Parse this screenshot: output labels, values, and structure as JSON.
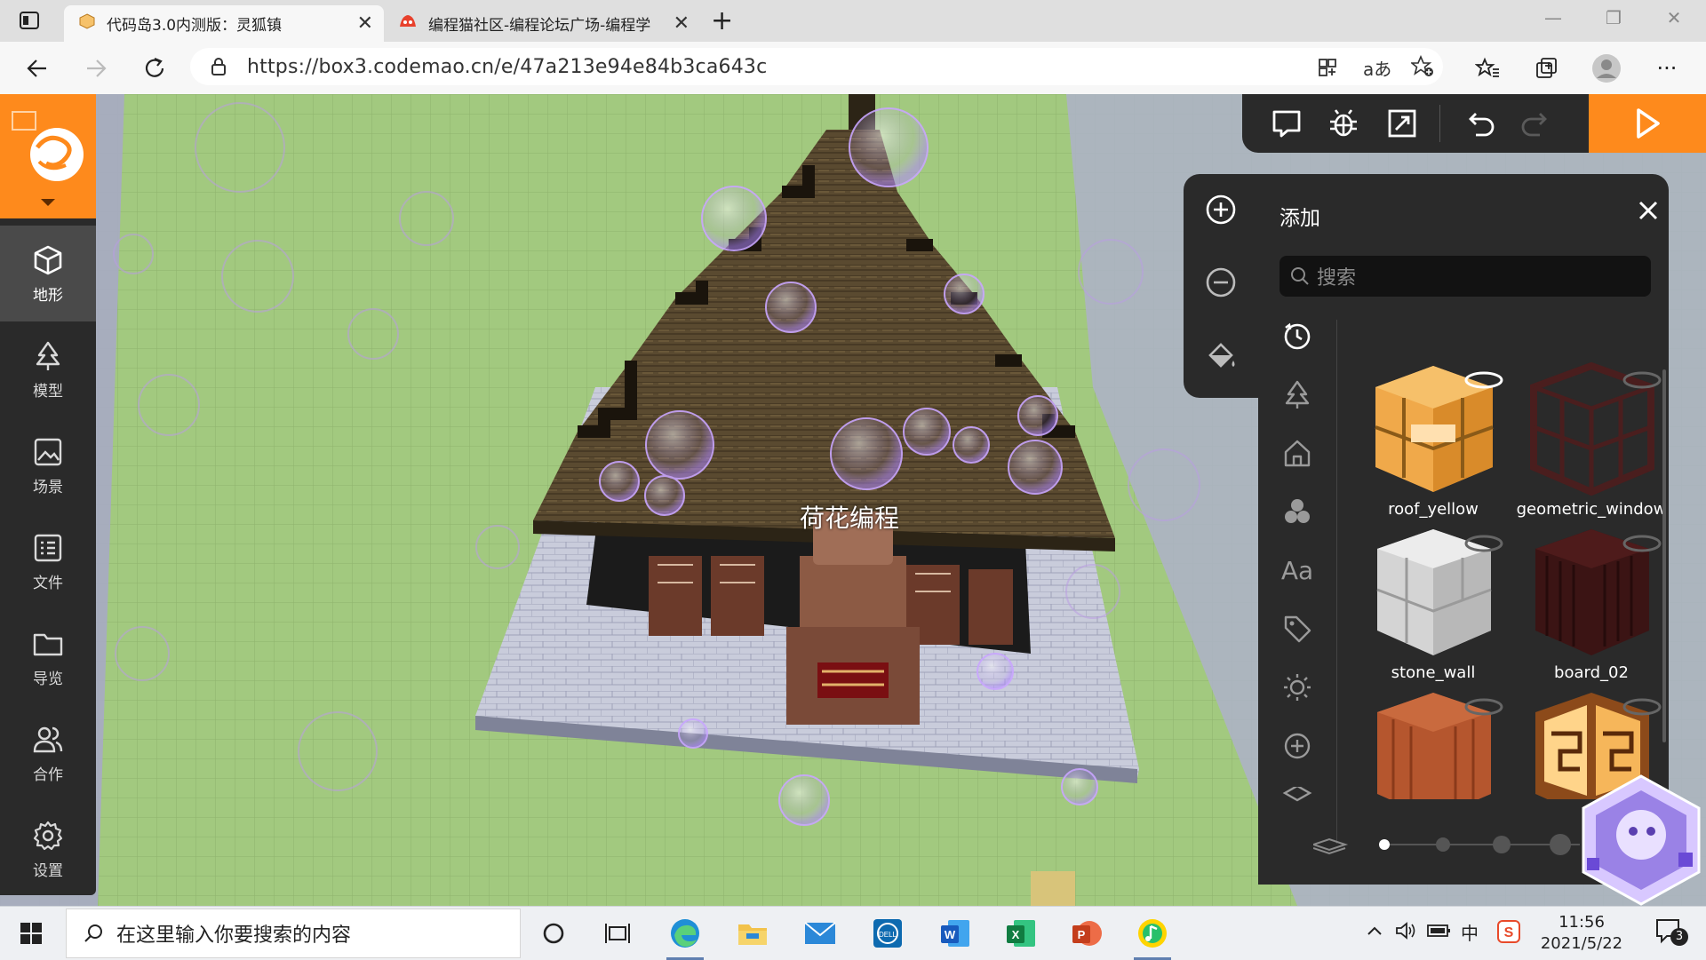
{
  "browser": {
    "tabs": [
      {
        "title": "代码岛3.0内测版：灵狐镇",
        "active": true
      },
      {
        "title": "编程猫社区-编程论坛广场-编程学",
        "active": false
      }
    ],
    "new_tab": "+",
    "url": "https://box3.codemao.cn/e/47a213e94e84b3ca643c"
  },
  "sidebar": {
    "items": [
      {
        "label": "地形",
        "icon": "cube-icon",
        "active": true
      },
      {
        "label": "模型",
        "icon": "tree-icon",
        "active": false
      },
      {
        "label": "场景",
        "icon": "picture-icon",
        "active": false
      },
      {
        "label": "文件",
        "icon": "list-icon",
        "active": false
      },
      {
        "label": "导览",
        "icon": "folder-icon",
        "active": false
      },
      {
        "label": "合作",
        "icon": "users-icon",
        "active": false
      },
      {
        "label": "设置",
        "icon": "gear-icon",
        "active": false
      }
    ]
  },
  "scene": {
    "player_name": "荷花编程"
  },
  "panel": {
    "title": "添加",
    "search_placeholder": "搜索",
    "items": [
      {
        "label": "roof_yellow",
        "color": "#f0a94a"
      },
      {
        "label": "geometric_window",
        "color": "#4a1e1e"
      },
      {
        "label": "stone_wall",
        "color": "#d9d9d9"
      },
      {
        "label": "board_02",
        "color": "#3b1414"
      },
      {
        "label": "",
        "color": "#b5562e"
      },
      {
        "label": "",
        "color": "#8c4a1a"
      }
    ],
    "categories": [
      "history-icon",
      "tree-icon",
      "house-icon",
      "shapes-icon",
      "text-icon",
      "tag-icon",
      "light-icon",
      "add-circle-icon",
      "layers-icon"
    ],
    "pager_active": 0,
    "pager_count": 4
  },
  "taskbar": {
    "search_placeholder": "在这里输入你要搜索的内容",
    "time": "11:56",
    "date": "2021/5/22",
    "notifications": "3",
    "ime": "中"
  },
  "colors": {
    "accent": "#fe8a1c",
    "panel_bg": "#2a2a2a",
    "grass": "#9ec57a"
  }
}
